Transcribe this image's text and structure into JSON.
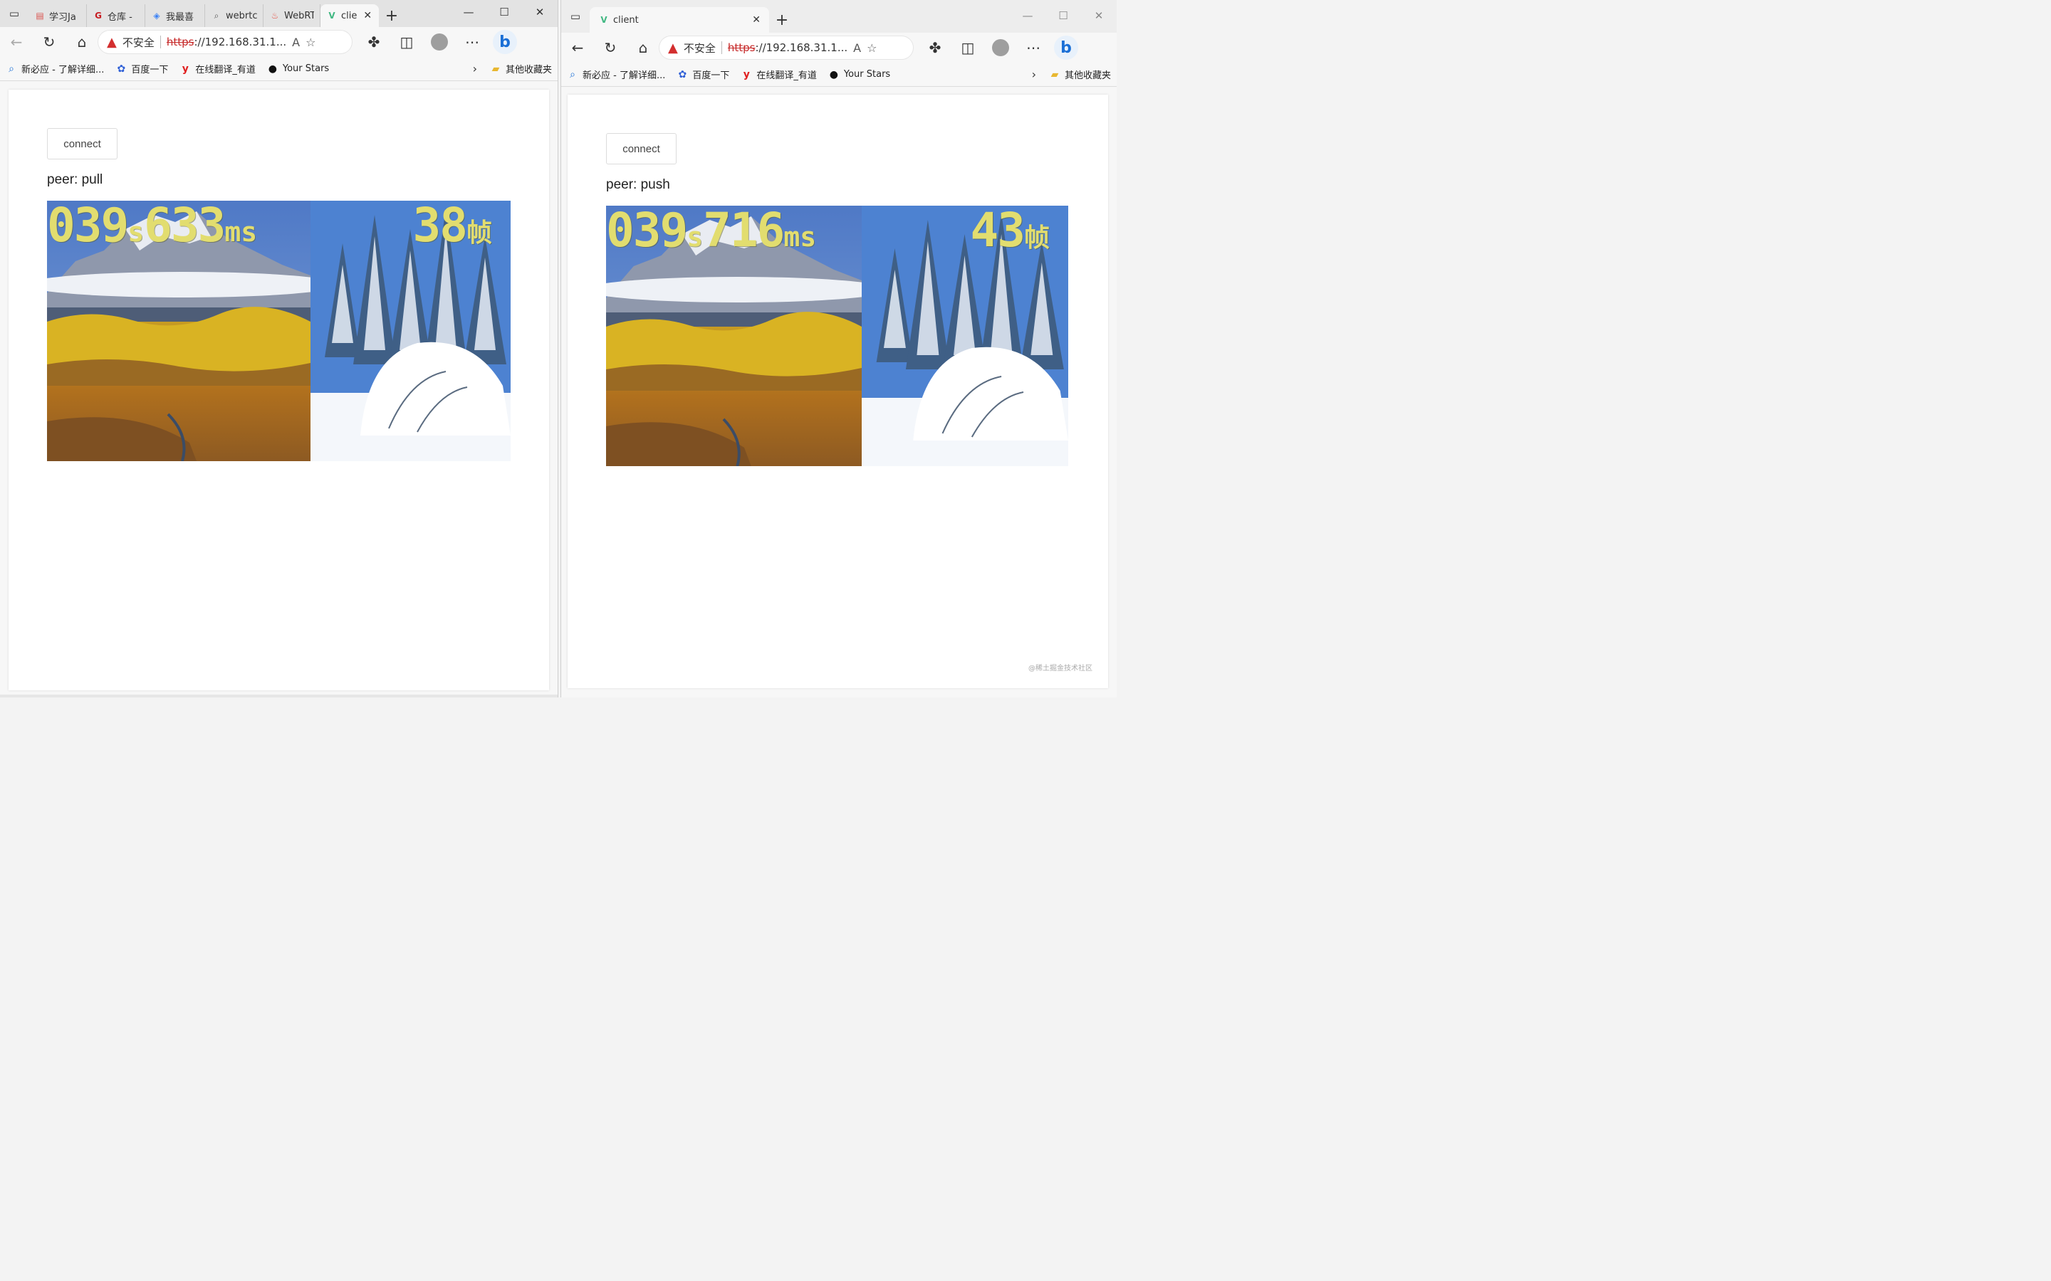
{
  "left": {
    "tabs": [
      {
        "icon": "pdf-icon",
        "glyph": "▤",
        "color": "#d9534f",
        "title": "学习Ja"
      },
      {
        "icon": "gitee-icon",
        "glyph": "G",
        "color": "#c71d23",
        "title": "仓库 - "
      },
      {
        "icon": "layers-icon",
        "glyph": "◈",
        "color": "#3b82f6",
        "title": "我最喜"
      },
      {
        "icon": "search-icon",
        "glyph": "🔍",
        "color": "#555555",
        "title": "webrtc"
      },
      {
        "icon": "flame-icon",
        "glyph": "♨",
        "color": "#e55a4e",
        "title": "WebRT"
      },
      {
        "icon": "vue-icon",
        "glyph": "V",
        "color": "#42b883",
        "title": "clie"
      }
    ],
    "address": {
      "warning": "不安全",
      "https": "https",
      "rest": "://192.168.31.1..."
    },
    "connect_label": "connect",
    "peer_label": "peer: pull",
    "overlay_time": {
      "seconds": "039",
      "s_unit": "s",
      "ms": "633",
      "ms_unit": "ms"
    },
    "overlay_fps": {
      "value": "38",
      "unit": "帧"
    }
  },
  "right": {
    "tabs": [
      {
        "icon": "vue-icon",
        "glyph": "V",
        "color": "#42b883",
        "title": "client"
      }
    ],
    "address": {
      "warning": "不安全",
      "https": "https",
      "rest": "://192.168.31.1..."
    },
    "connect_label": "connect",
    "peer_label": "peer: push",
    "overlay_time": {
      "seconds": "039",
      "s_unit": "s",
      "ms": "716",
      "ms_unit": "ms"
    },
    "overlay_fps": {
      "value": "43",
      "unit": "帧"
    },
    "watermark": "@稀土掘金技术社区"
  },
  "bookmarks": [
    {
      "icon": "search-icon",
      "glyph": "🔍",
      "label": "新必应 - 了解详细..."
    },
    {
      "icon": "baidu-icon",
      "glyph": "🐾",
      "label": "百度一下"
    },
    {
      "icon": "youdao-icon",
      "glyph": "y",
      "label": "在线翻译_有道"
    },
    {
      "icon": "github-icon",
      "glyph": "●",
      "label": "Your Stars"
    }
  ],
  "other_bookmarks": "其他收藏夹"
}
